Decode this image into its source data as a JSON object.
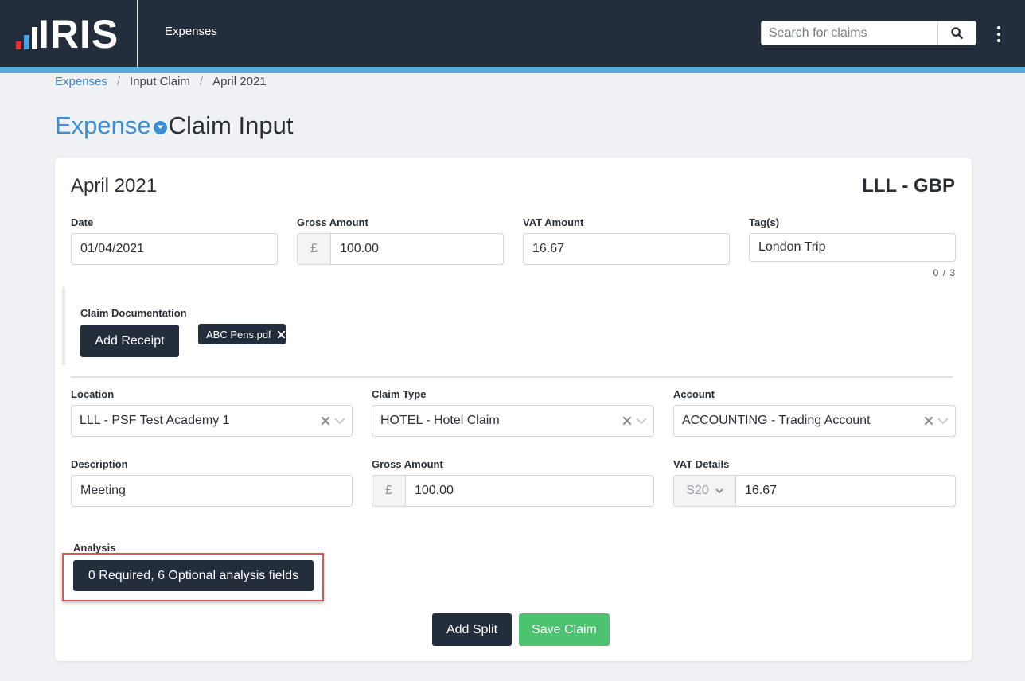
{
  "header": {
    "logo_text": "IRIS",
    "app_title": "Expenses",
    "search_placeholder": "Search for claims",
    "icons": {
      "search": "search-icon",
      "menu": "kebab-menu-icon"
    }
  },
  "breadcrumb": {
    "items": [
      "Expenses",
      "Input Claim",
      "April 2021"
    ]
  },
  "page": {
    "title_accent": "Expense",
    "title_rest": "Claim Input"
  },
  "card": {
    "period": "April 2021",
    "currency": "LLL - GBP",
    "date_label": "Date",
    "date_value": "01/04/2021",
    "gross_label": "Gross Amount",
    "gross_prefix": "£",
    "gross_value": "100.00",
    "vat_label": "VAT Amount",
    "vat_value": "16.67",
    "tags_label": "Tag(s)",
    "tags_value": "London Trip",
    "tags_count": "0 / 3",
    "doc_label": "Claim Documentation",
    "add_receipt": "Add Receipt",
    "attachment": "ABC Pens.pdf",
    "location_label": "Location",
    "location_value": "LLL - PSF Test Academy 1",
    "claim_type_label": "Claim Type",
    "claim_type_value": "HOTEL - Hotel Claim",
    "account_label": "Account",
    "account_value": "ACCOUNTING - Trading Account",
    "description_label": "Description",
    "description_value": "Meeting",
    "split_gross_label": "Gross Amount",
    "split_gross_prefix": "£",
    "split_gross_value": "100.00",
    "vat_details_label": "VAT Details",
    "vat_code": "S20",
    "vat_details_value": "16.67",
    "analysis_label": "Analysis",
    "analysis_button": "0 Required, 6 Optional analysis fields",
    "add_split": "Add Split",
    "save_claim": "Save Claim"
  },
  "colors": {
    "navbar": "#232d3b",
    "accent_stripe": "#5aa9e0",
    "link_blue": "#3b82c4",
    "save_green": "#4cc36f",
    "highlight_red": "#e05555"
  }
}
